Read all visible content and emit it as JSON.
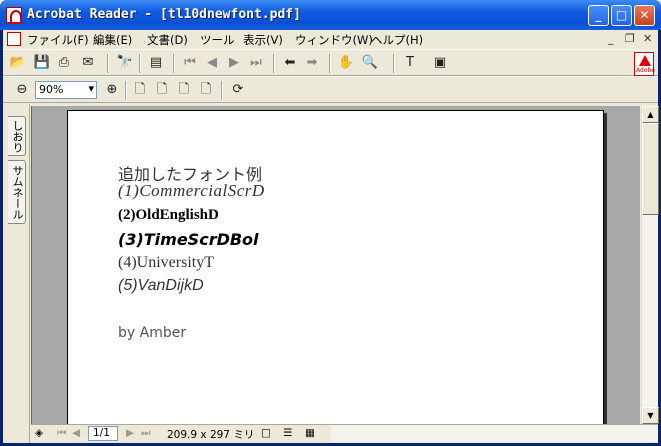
{
  "window": {
    "title": "Acrobat Reader - [tl10dnewfont.pdf]"
  },
  "title_buttons": {
    "minimize": "_",
    "maximize": "□",
    "close": "✕"
  },
  "menu": {
    "items": [
      "ファイル(F)",
      "編集(E)",
      "文書(D)",
      "ツール",
      "表示(V)",
      "ウィンドウ(W)",
      "ヘルプ(H)"
    ],
    "mdi": {
      "minimize": "_",
      "restore": "❐",
      "close": "✕"
    }
  },
  "toolbar1": {
    "icons": [
      "open-icon",
      "save-icon",
      "print-icon",
      "email-icon",
      "find-icon",
      "navigation-pane-icon",
      "first-page-icon",
      "prev-page-icon",
      "next-page-icon",
      "last-page-icon",
      "go-back-icon",
      "go-forward-icon",
      "hand-tool-icon",
      "zoom-tool-icon",
      "text-select-icon",
      "snapshot-icon"
    ]
  },
  "toolbar2": {
    "zoom_value": "90%",
    "icons": [
      "zoom-out-icon",
      "zoom-in-icon",
      "actual-size-icon",
      "fit-page-icon",
      "fit-width-icon",
      "fit-visible-icon",
      "rotate-icon"
    ]
  },
  "side_tabs": {
    "bookmarks": "しおり",
    "thumbnails": "サムネール"
  },
  "document": {
    "lines": [
      "追加したフォント例",
      "(1)CommercialScrD",
      "(2)OldEnglishD",
      "(3)TimeScrDBol",
      "(4)UniversityT",
      "(5)VanDijkD",
      "by Amber"
    ]
  },
  "statusbar": {
    "page": "1/1",
    "page_size": "209.9 x 297 ミリ"
  },
  "colors": {
    "titlebar": "#0a4fd3",
    "viewer_bg": "#a8a8a8",
    "adobe_red": "#dd0000"
  }
}
